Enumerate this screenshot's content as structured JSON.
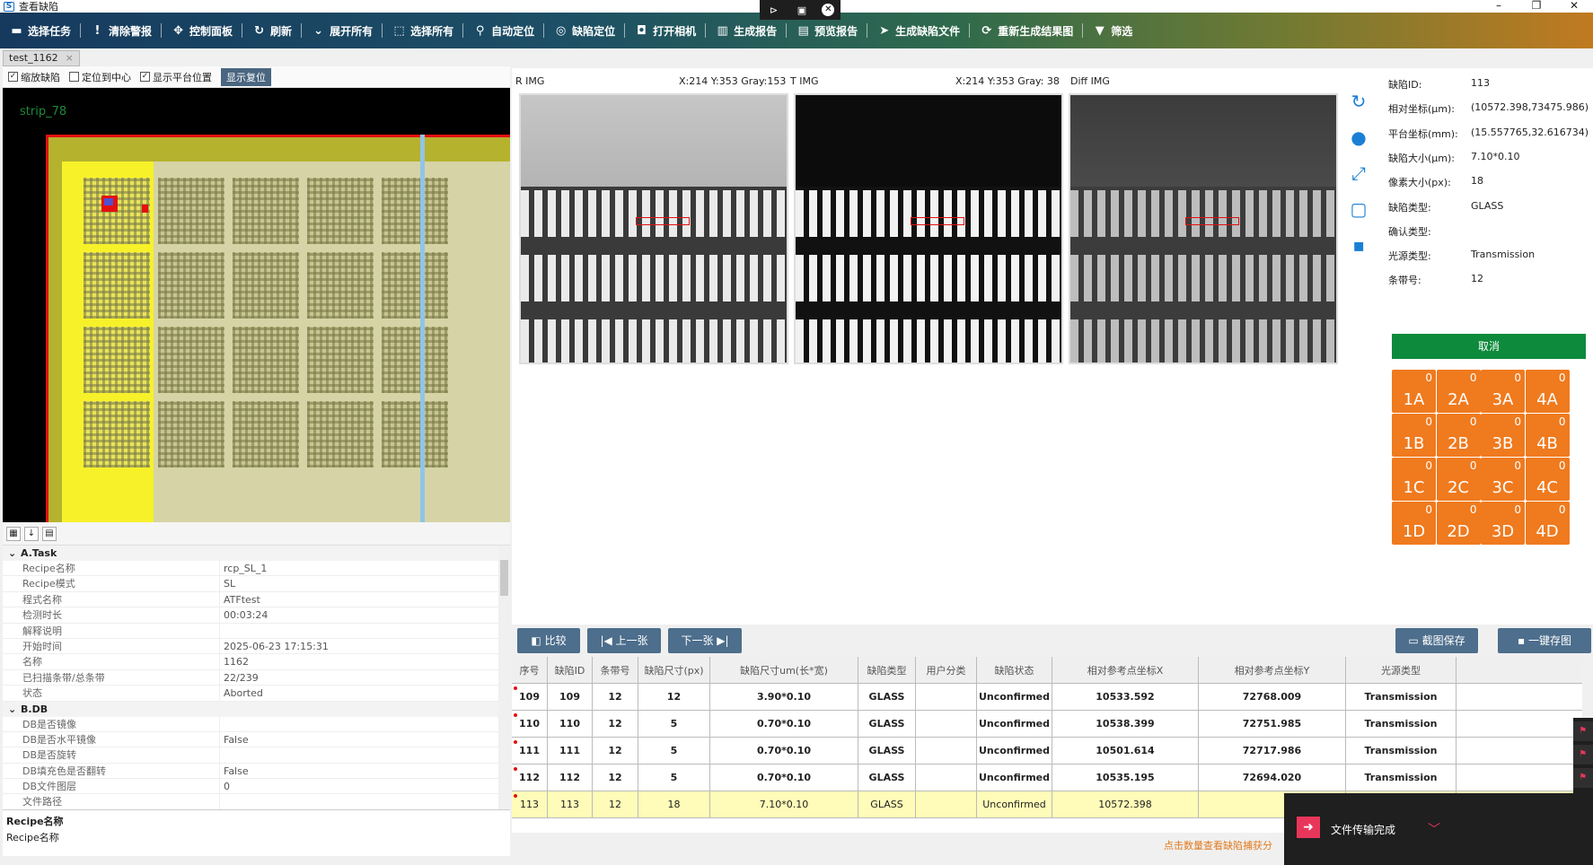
{
  "window": {
    "title": "查看缺陷",
    "minimize": "–",
    "maximize": "❐",
    "close": "✕"
  },
  "floatbar": {
    "icons": [
      "pin-icon",
      "screen-icon",
      "close-icon"
    ]
  },
  "toolbar": {
    "items": [
      {
        "label": "选择任务",
        "icon": "folder-icon"
      },
      {
        "label": "清除警报",
        "icon": "alert-icon"
      },
      {
        "label": "控制面板",
        "icon": "move-icon"
      },
      {
        "label": "刷新",
        "icon": "refresh-icon"
      },
      {
        "label": "展开所有",
        "icon": "chevron-down-icon"
      },
      {
        "label": "选择所有",
        "icon": "select-all-icon"
      },
      {
        "label": "自动定位",
        "icon": "location-pin-icon"
      },
      {
        "label": "缺陷定位",
        "icon": "crosshair-icon"
      },
      {
        "label": "打开相机",
        "icon": "camera-icon"
      },
      {
        "label": "生成报告",
        "icon": "chart-report-icon"
      },
      {
        "label": "预览报告",
        "icon": "pdf-icon"
      },
      {
        "label": "生成缺陷文件",
        "icon": "send-icon"
      },
      {
        "label": "重新生成结果图",
        "icon": "regenerate-icon"
      },
      {
        "label": "筛选",
        "icon": "filter-icon"
      }
    ]
  },
  "doc_tab": {
    "label": "test_1162",
    "close": "×"
  },
  "map_options": {
    "zoom_defect": "缩放缺陷",
    "center": "定位到中心",
    "show_platform": "显示平台位置",
    "reset": "显示复位"
  },
  "map": {
    "strip_label": "strip_78"
  },
  "props": {
    "groups": [
      {
        "title": "A.Task",
        "rows": [
          {
            "k": "Recipe名称",
            "v": "rcp_SL_1"
          },
          {
            "k": "Recipe模式",
            "v": "SL"
          },
          {
            "k": "程式名称",
            "v": "ATFtest"
          },
          {
            "k": "检测时长",
            "v": "00:03:24"
          },
          {
            "k": "解释说明",
            "v": ""
          },
          {
            "k": "开始时间",
            "v": "2025-06-23 17:15:31"
          },
          {
            "k": "名称",
            "v": "1162"
          },
          {
            "k": "已扫描条带/总条带",
            "v": "22/239"
          },
          {
            "k": "状态",
            "v": "Aborted"
          }
        ]
      },
      {
        "title": "B.DB",
        "rows": [
          {
            "k": "DB是否镜像",
            "v": ""
          },
          {
            "k": "DB是否水平镜像",
            "v": "False"
          },
          {
            "k": "DB是否旋转",
            "v": ""
          },
          {
            "k": "DB填充色是否翻转",
            "v": "False"
          },
          {
            "k": "DB文件图层",
            "v": "0"
          },
          {
            "k": "文件路径",
            "v": ""
          }
        ]
      }
    ],
    "desc_title": "Recipe名称",
    "desc_text": "Recipe名称"
  },
  "images": {
    "r": {
      "label": "R IMG",
      "coord": "X:214 Y:353 Gray:153"
    },
    "t": {
      "label": "T IMG",
      "coord": "X:214 Y:353 Gray:  38"
    },
    "diff": {
      "label": "Diff IMG"
    }
  },
  "side_icons": [
    "refresh-icon",
    "palette-icon",
    "fit-icon",
    "crop-icon",
    "save-icon"
  ],
  "defect_info": {
    "rows": [
      {
        "k": "缺陷ID:",
        "v": "113"
      },
      {
        "k": "相对坐标(μm):",
        "v": "(10572.398,73475.986)"
      },
      {
        "k": "平台坐标(mm):",
        "v": "(15.557765,32.616734)"
      },
      {
        "k": "缺陷大小(μm):",
        "v": "7.10*0.10"
      },
      {
        "k": "像素大小(px):",
        "v": "18"
      },
      {
        "k": "缺陷类型:",
        "v": "GLASS"
      },
      {
        "k": "确认类型:",
        "v": ""
      },
      {
        "k": "光源类型:",
        "v": "Transmission"
      },
      {
        "k": "条带号:",
        "v": "12"
      }
    ],
    "cancel": "取消"
  },
  "classes": [
    {
      "label": "1A",
      "count": "0"
    },
    {
      "label": "2A",
      "count": "0"
    },
    {
      "label": "3A",
      "count": "0"
    },
    {
      "label": "4A",
      "count": "0"
    },
    {
      "label": "1B",
      "count": "0"
    },
    {
      "label": "2B",
      "count": "0"
    },
    {
      "label": "3B",
      "count": "0"
    },
    {
      "label": "4B",
      "count": "0"
    },
    {
      "label": "1C",
      "count": "0"
    },
    {
      "label": "2C",
      "count": "0"
    },
    {
      "label": "3C",
      "count": "0"
    },
    {
      "label": "4C",
      "count": "0"
    },
    {
      "label": "1D",
      "count": "0"
    },
    {
      "label": "2D",
      "count": "0"
    },
    {
      "label": "3D",
      "count": "0"
    },
    {
      "label": "4D",
      "count": "0"
    }
  ],
  "actions": {
    "compare": "比较",
    "prev": "上一张",
    "next": "下一张",
    "screenshot_save": "截图保存",
    "one_key_save": "一键存图"
  },
  "table": {
    "headers": [
      "序号",
      "缺陷ID",
      "条带号",
      "缺陷尺寸(px)",
      "缺陷尺寸um(长*宽)",
      "缺陷类型",
      "用户分类",
      "缺陷状态",
      "相对参考点坐标X",
      "相对参考点坐标Y",
      "光源类型"
    ],
    "rows": [
      [
        "109",
        "109",
        "12",
        "12",
        "3.90*0.10",
        "GLASS",
        "",
        "Unconfirmed",
        "10533.592",
        "72768.009",
        "Transmission"
      ],
      [
        "110",
        "110",
        "12",
        "5",
        "0.70*0.10",
        "GLASS",
        "",
        "Unconfirmed",
        "10538.399",
        "72751.985",
        "Transmission"
      ],
      [
        "111",
        "111",
        "12",
        "5",
        "0.70*0.10",
        "GLASS",
        "",
        "Unconfirmed",
        "10501.614",
        "72717.986",
        "Transmission"
      ],
      [
        "112",
        "112",
        "12",
        "5",
        "0.70*0.10",
        "GLASS",
        "",
        "Unconfirmed",
        "10535.195",
        "72694.020",
        "Transmission"
      ],
      [
        "113",
        "113",
        "12",
        "18",
        "7.10*0.10",
        "GLASS",
        "",
        "Unconfirmed",
        "10572.398",
        "",
        ""
      ]
    ],
    "selected_index": 4,
    "hint": "点击数量查看缺陷捕获分"
  },
  "toast": {
    "text": "文件传输完成"
  }
}
